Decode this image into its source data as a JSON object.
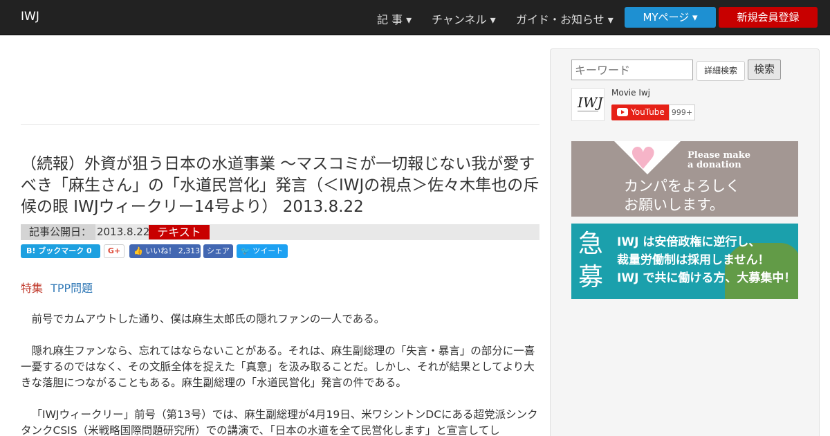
{
  "nav": {
    "brand": "IWJ",
    "items": [
      "記 事 ▾",
      "チャンネル ▾",
      "ガイド・お知らせ ▾"
    ],
    "mypage": "MYページ ▾",
    "register": "新規会員登録"
  },
  "article": {
    "title": "（続報）外資が狙う日本の水道事業 ～マスコミが一切報じない我が愛すべき「麻生さん」の「水道民営化」発言（＜IWJの視点＞佐々木隼也の斥候の眼 IWJウィークリー14号より） 2013.8.22",
    "published_label": "記事公開日：",
    "published_date": "2013.8.22",
    "badge": "テキスト",
    "tag_label": "特集",
    "tag_link": "TPP問題",
    "paragraphs": [
      "前号でカムアウトした通り、僕は麻生太郎氏の隠れファンの一人である。",
      "隠れ麻生ファンなら、忘れてはならないことがある。それは、麻生副総理の「失言・暴言」の部分に一喜一憂するのではなく、その文脈全体を捉えた「真意」を汲み取ることだ。しかし、それが結果としてより大きな落胆につながることもある。麻生副総理の「水道民営化」発言の件である。",
      "「IWJウィークリー」前号（第13号）では、麻生副総理が4月19日、米ワシントンDCにある超党派シンクタンクCSIS（米戦略国際問題研究所）での講演で、「日本の水道を全て民営化します」と宣言してし"
    ]
  },
  "share": {
    "hatena": "B! ブックマーク  0",
    "gplus": "G+",
    "fb_like": "👍 いいね！ 2,313",
    "fb_share": "シェア",
    "tweet": "🐦 ツイート"
  },
  "sidebar": {
    "search_placeholder": "キーワード",
    "advanced_search": "詳細検索",
    "search_button": "検索",
    "youtube_channel": "Movie Iwj",
    "youtube_button": "YouTube",
    "youtube_count": "999+",
    "logo_text": "IWJ",
    "donate_en_1": "Please make",
    "donate_en_2": "a donation",
    "donate_ja_1": "カンパをよろしく",
    "donate_ja_2": "お願いします。",
    "recruit_big_1": "急",
    "recruit_big_2": "募",
    "recruit_line_1": "IWJ は安倍政権に逆行し、",
    "recruit_line_2": "裁量労働制は採用しません！",
    "recruit_line_3": "IWJ で共に働ける方、大募集中！"
  }
}
